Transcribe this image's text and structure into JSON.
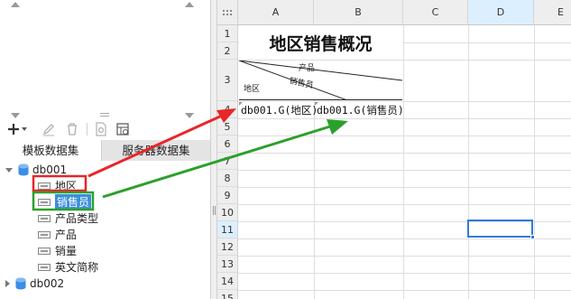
{
  "left_panel": {
    "toolbar_icons": [
      "add-icon",
      "edit-icon",
      "delete-icon",
      "preview-icon",
      "server-data-icon"
    ],
    "tabs": [
      {
        "label": "模板数据集"
      },
      {
        "label": "服务器数据集"
      }
    ],
    "tree": {
      "db1": {
        "name": "db001",
        "fields": [
          {
            "label": "地区"
          },
          {
            "label": "销售员"
          },
          {
            "label": "产品类型"
          },
          {
            "label": "产品"
          },
          {
            "label": "销量"
          },
          {
            "label": "英文简称"
          }
        ]
      },
      "db2": {
        "name": "db002"
      }
    }
  },
  "sheet": {
    "columns": [
      "A",
      "B",
      "C",
      "D",
      "E"
    ],
    "active_column": "D",
    "rows": [
      "1",
      "2",
      "3",
      "4",
      "5",
      "6",
      "7",
      "8",
      "9",
      "10",
      "11",
      "12",
      "13",
      "14",
      "15"
    ],
    "active_row": "11",
    "title": "地区销售概况",
    "slash_header": {
      "top": "产品",
      "middle": "销售员",
      "bottom": "地区"
    },
    "cells": {
      "a4": "db001.G(地区)",
      "b4": "db001.G(销售员)"
    }
  },
  "annotations": {
    "red_color": "#e8262a",
    "green_color": "#2ca02c",
    "selection_color": "#2f7be0"
  }
}
